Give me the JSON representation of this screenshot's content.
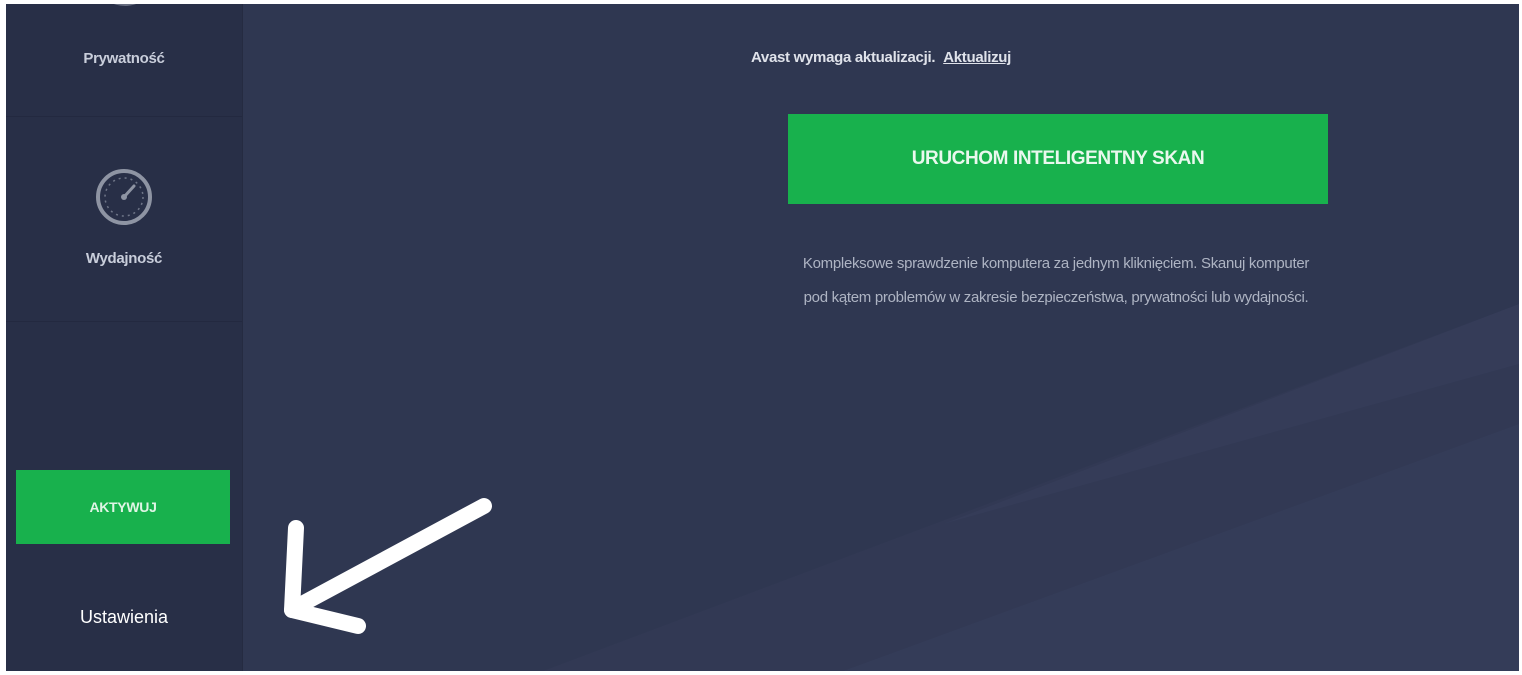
{
  "sidebar": {
    "privacy_label": "Prywatność",
    "performance_label": "Wydajność",
    "activate_label": "AKTYWUJ",
    "settings_label": "Ustawienia",
    "icons": {
      "privacy": "privacy-icon",
      "performance": "speedometer-icon"
    }
  },
  "main": {
    "update_text": "Avast wymaga aktualizacji.",
    "update_link": "Aktualizuj",
    "scan_button": "URUCHOM INTELIGENTNY SKAN",
    "scan_desc_line1": "Kompleksowe sprawdzenie komputera za jednym kliknięciem. Skanuj komputer",
    "scan_desc_line2": "pod kątem problemów w zakresie bezpieczeństwa, prywatności lub wydajności."
  },
  "colors": {
    "background": "#2f3751",
    "sidebar": "#282f47",
    "accent_green": "#18b14d",
    "text_light": "#dfe2ea"
  }
}
